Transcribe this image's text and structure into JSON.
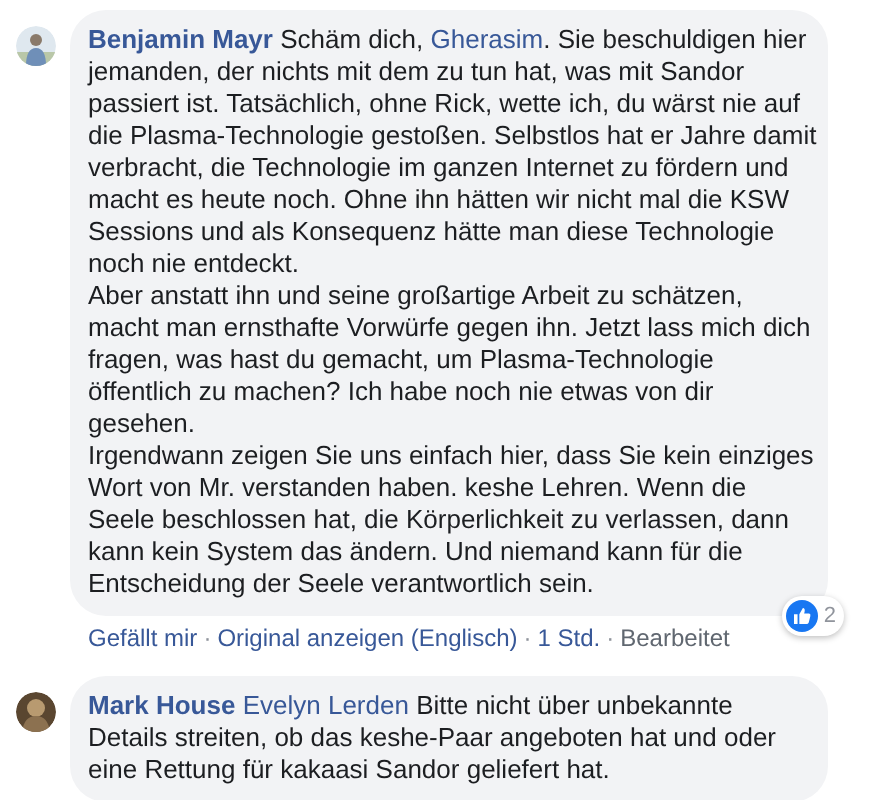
{
  "separator": "·",
  "comments": [
    {
      "author": "Benjamin Mayr",
      "lead": [
        {
          "kind": "text",
          "text": "Schäm dich, "
        },
        {
          "kind": "mention",
          "text": "Gherasim"
        },
        {
          "kind": "text",
          "text": ". Sie beschuldigen hier jemanden, der nichts mit dem zu tun hat, was mit Sandor passiert ist. Tatsächlich, ohne Rick, wette ich, du wärst nie auf die Plasma-Technologie gestoßen. Selbstlos hat er Jahre damit verbracht, die Technologie im ganzen Internet zu fördern und macht es heute noch. Ohne ihn hätten wir nicht mal die KSW Sessions und als Konsequenz hätte man diese Technologie noch nie entdeckt."
        }
      ],
      "paragraphs": [
        "Aber anstatt ihn und seine großartige Arbeit zu schätzen, macht man ernsthafte Vorwürfe gegen ihn. Jetzt lass mich dich fragen, was hast du gemacht, um Plasma-Technologie öffentlich zu machen? Ich habe noch nie etwas von dir gesehen.",
        "Irgendwann zeigen Sie uns einfach hier, dass Sie kein einziges Wort von Mr. verstanden haben. keshe Lehren. Wenn die Seele beschlossen hat, die Körperlichkeit zu verlassen, dann kann kein System das ändern. Und niemand kann für die Entscheidung der Seele verantwortlich sein."
      ],
      "actions": [
        {
          "kind": "link",
          "text": "Gefällt mir"
        },
        {
          "kind": "link",
          "text": "Original anzeigen (Englisch)"
        },
        {
          "kind": "time",
          "text": "1 Std."
        },
        {
          "kind": "note",
          "text": "Bearbeitet"
        }
      ],
      "reactions": "2"
    },
    {
      "author": "Mark House",
      "lead": [
        {
          "kind": "mention",
          "text": "Evelyn Lerden"
        },
        {
          "kind": "text",
          "text": " Bitte nicht über unbekannte Details streiten, ob das keshe-Paar angeboten hat und oder eine Rettung für kakaasi Sandor geliefert hat."
        }
      ]
    }
  ]
}
